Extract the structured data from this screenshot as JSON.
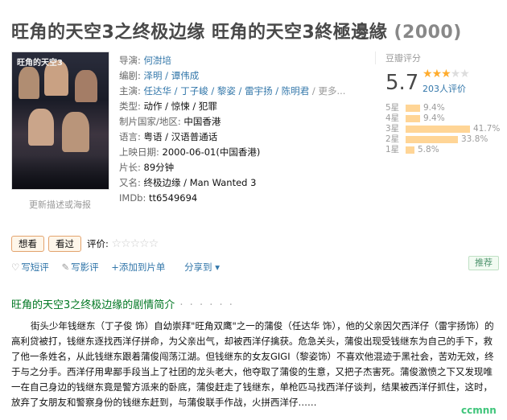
{
  "title": {
    "main": "旺角的天空3之终极边缘 旺角的天空3終極邊緣",
    "year": "(2000)"
  },
  "poster": {
    "logo": "旺角的天空3",
    "link": "更新描述或海报"
  },
  "info": [
    {
      "label": "导演: ",
      "value": "何澍培",
      "link": true
    },
    {
      "label": "编剧: ",
      "value": "泽明 / 谭伟成",
      "link": true
    },
    {
      "label": "主演: ",
      "value": "任达华 / 丁子峻 / 黎姿 / 雷宇扬 / 陈明君",
      "link": true,
      "more": " / 更多..."
    },
    {
      "label": "类型: ",
      "value": "动作 / 惊悚 / 犯罪",
      "link": false
    },
    {
      "label": "制片国家/地区: ",
      "value": "中国香港",
      "link": false
    },
    {
      "label": "语言: ",
      "value": "粤语 / 汉语普通话",
      "link": false
    },
    {
      "label": "上映日期: ",
      "value": "2000-06-01(中国香港)",
      "link": false
    },
    {
      "label": "片长: ",
      "value": "89分钟",
      "link": false
    },
    {
      "label": "又名: ",
      "value": "终极边缘 / Man Wanted 3",
      "link": false
    },
    {
      "label": "IMDb: ",
      "value": "tt6549694",
      "link": false
    }
  ],
  "rating": {
    "title": "豆瓣评分",
    "score": "5.7",
    "stars_on": 3,
    "stars_total": 5,
    "people": "203人评价",
    "distribution": [
      {
        "label": "5星",
        "pct": "9.4%",
        "value": 9.4
      },
      {
        "label": "4星",
        "pct": "9.4%",
        "value": 9.4
      },
      {
        "label": "3星",
        "pct": "41.7%",
        "value": 41.7
      },
      {
        "label": "2星",
        "pct": "33.8%",
        "value": 33.8
      },
      {
        "label": "1星",
        "pct": "5.8%",
        "value": 5.8
      }
    ],
    "colors": {
      "star": "#ffac2d",
      "bar": "#ffd596"
    }
  },
  "actions": {
    "want": "想看",
    "seen": "看过",
    "rate_label": "评价:",
    "rate_stars": "☆☆☆☆☆"
  },
  "links": {
    "short_review": "写短评",
    "review": "写影评",
    "add_list": "+添加到片单",
    "share": "分享到 ▾",
    "recommend": "推荐",
    "icons": {
      "short_review": "comment-icon",
      "review": "edit-icon"
    }
  },
  "summary": {
    "title": "旺角的天空3之终极边缘的剧情简介",
    "dots": " · · · · · ·",
    "text": "街头少年钱继东（丁子俊 饰）自幼崇拜\"旺角双鹰\"之一的蒲俊（任达华 饰），他的父亲因欠西洋仔（雷宇扬饰）的高利贷被打，钱继东逐找西洋仔拼命，为父亲出气，却被西洋仔擒获。危急关头，蒲俊出现受钱继东为自己的手下，救了他一条姓名，从此钱继东跟着蒲俊闯荡江湖。但钱继东的女友GIGI（黎姿饰）不喜欢他混迹于黑社会，苦劝无效，终于与之分手。西洋仔用卑鄙手段当上了社团的龙头老大，他夺取了蒲俊的生意，又把子杰害死。蒲俊激愤之下又发现唯一在自己身边的钱继东竟是警方派来的卧底，蒲俊赶走了钱继东，单枪匹马找西洋仔谈判，结果被西洋仔抓住，这时，放弃了女朋友和警察身份的钱继东赶到，与蒲俊联手作战，火拼西洋仔……"
  },
  "watermark": "ccmnn"
}
